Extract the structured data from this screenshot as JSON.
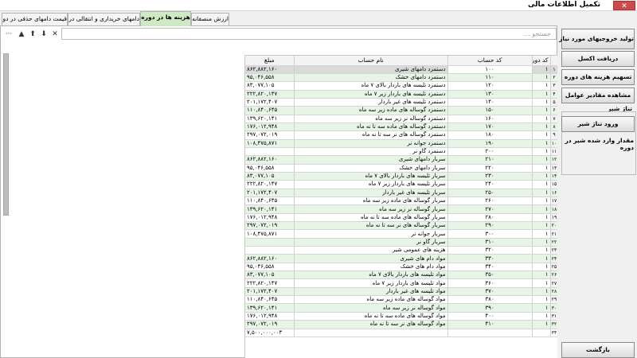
{
  "window": {
    "title": "تکمیل اطلاعات مالی",
    "close_label": "✕"
  },
  "tabs": [
    "ارزش منصفانه",
    "هزینه ها در دوره",
    "دامهای خریداری و انتقالی در دوره",
    "قیمت دامهای حذفی در دوره"
  ],
  "active_tab": "هزینه ها در دوره",
  "toolbar": {
    "more": "···",
    "up": "▲",
    "up2": "⬆",
    "down": "⬇",
    "clear": "✕"
  },
  "search": {
    "placeholder": "جستجو ..."
  },
  "grid": {
    "columns": {
      "period": "کد دوره",
      "account_code": "کد حساب",
      "account_name": "نام حساب",
      "amount": "مبلغ"
    },
    "rows": [
      {
        "row": "۱",
        "period": "۱",
        "code": "۱۰۰",
        "name": "دستمزد دامهای شیری",
        "amount": "۸۶۲,۸۸۲,۱۶۰"
      },
      {
        "row": "۲",
        "period": "۱",
        "code": "۱۱۰",
        "name": "دستمزد دامهای خشک",
        "amount": "۹۵,۰۴۶,۵۵۸"
      },
      {
        "row": "۳",
        "period": "۱",
        "code": "۱۲۰",
        "name": "دستمزد تلیسه های باردار بالای ۷ ماه",
        "amount": "۸۳,۰۷۷,۱۰۵"
      },
      {
        "row": "۴",
        "period": "۱",
        "code": "۱۳۰",
        "name": "دستمزد تلیسه های باردار زیر ۷ ماه",
        "amount": "۲۲۲,۸۲۰,۱۴۷"
      },
      {
        "row": "۵",
        "period": "۱",
        "code": "۱۴۰",
        "name": "دستمزد تلیسه های غیر باردار",
        "amount": "۲۰۱,۱۷۲,۴۰۷"
      },
      {
        "row": "۶",
        "period": "۱",
        "code": "۱۵۰",
        "name": "دستمزد گوساله های ماده زیر سه ماه",
        "amount": "۱۱۰,۸۴۰,۶۴۵"
      },
      {
        "row": "۷",
        "period": "۱",
        "code": "۱۶۰",
        "name": "دستمزد گوساله نر زیر سه ماه",
        "amount": "۱۳۹,۶۲۰,۱۴۱"
      },
      {
        "row": "۸",
        "period": "۱",
        "code": "۱۷۰",
        "name": "دستمزد گوساله های ماده سه تا نه ماه",
        "amount": "۱۷۶,۰۱۲,۹۴۸"
      },
      {
        "row": "۹",
        "period": "۱",
        "code": "۱۸۰",
        "name": "دستمزد گوساله های نر سه تا نه ماه",
        "amount": "۲۹۷,۰۷۲,۰۱۹"
      },
      {
        "row": "۱۰",
        "period": "۱",
        "code": "۱۹۰",
        "name": "دستمزد جوانه نر",
        "amount": "۱۰۸,۴۷۵,۸۷۱"
      },
      {
        "row": "۱۱",
        "period": "۱",
        "code": "۲۰۰",
        "name": "دستمزد گاو نر",
        "amount": ""
      },
      {
        "row": "۱۲",
        "period": "۱",
        "code": "۲۱۰",
        "name": "سربار دامهای شیری",
        "amount": "۸۶۲,۸۸۲,۱۶۰"
      },
      {
        "row": "۱۳",
        "period": "۱",
        "code": "۲۲۰",
        "name": "سربار دامهای خشک",
        "amount": "۹۵,۰۴۶,۵۵۸"
      },
      {
        "row": "۱۴",
        "period": "۱",
        "code": "۲۳۰",
        "name": "سربار تلیسه های باردار بالای ۷ ماه",
        "amount": "۸۳,۰۷۷,۱۰۵"
      },
      {
        "row": "۱۵",
        "period": "۱",
        "code": "۲۴۰",
        "name": "سربار تلیسه های باردار زیر ۷ ماه",
        "amount": "۲۲۲,۸۲۰,۱۴۷"
      },
      {
        "row": "۱۶",
        "period": "۱",
        "code": "۲۵۰",
        "name": "سربار تلیسه های غیر باردار",
        "amount": "۲۰۱,۱۷۲,۴۰۷"
      },
      {
        "row": "۱۷",
        "period": "۱",
        "code": "۲۶۰",
        "name": "سربار گوساله های ماده زیر سه ماه",
        "amount": "۱۱۰,۸۴۰,۶۴۵"
      },
      {
        "row": "۱۸",
        "period": "۱",
        "code": "۲۷۰",
        "name": "سربار گوساله نر زیر سه ماه",
        "amount": "۱۳۹,۶۲۰,۱۴۱"
      },
      {
        "row": "۱۹",
        "period": "۱",
        "code": "۲۸۰",
        "name": "سربار گوساله های ماده سه تا نه ماه",
        "amount": "۱۷۶,۰۱۲,۹۴۸"
      },
      {
        "row": "۲۰",
        "period": "۱",
        "code": "۲۹۰",
        "name": "سربار گوساله های نر سه تا نه ماه",
        "amount": "۲۹۷,۰۷۲,۰۱۹"
      },
      {
        "row": "۲۱",
        "period": "۱",
        "code": "۳۰۰",
        "name": "سربار جوانه نر",
        "amount": "۱۰۸,۴۷۵,۸۷۱"
      },
      {
        "row": "۲۲",
        "period": "۱",
        "code": "۳۱۰",
        "name": "سربار گاو نر",
        "amount": ""
      },
      {
        "row": "۲۳",
        "period": "۱",
        "code": "۳۲۰",
        "name": "هزینه های عمومی شیر",
        "amount": ""
      },
      {
        "row": "۲۴",
        "period": "۱",
        "code": "۳۳۰",
        "name": "مواد دام های شیری",
        "amount": "۸۶۲,۸۸۲,۱۶۰"
      },
      {
        "row": "۲۵",
        "period": "۱",
        "code": "۳۴۰",
        "name": "مواد دام های خشک",
        "amount": "۹۵,۰۴۶,۵۵۸"
      },
      {
        "row": "۲۶",
        "period": "۱",
        "code": "۳۵۰",
        "name": "مواد تلیسه های باردار بالای ۷ ماه",
        "amount": "۸۳,۰۷۷,۱۰۵"
      },
      {
        "row": "۲۷",
        "period": "۱",
        "code": "۳۶۰",
        "name": "مواد تلیسه های باردار زیر ۷ ماه",
        "amount": "۲۲۲,۸۲۰,۱۴۷"
      },
      {
        "row": "۲۸",
        "period": "۱",
        "code": "۳۷۰",
        "name": "مواد تلیسه های غیر باردار",
        "amount": "۲۰۱,۱۷۲,۴۰۷"
      },
      {
        "row": "۲۹",
        "period": "۱",
        "code": "۳۸۰",
        "name": "مواد گوساله های ماده زیر سه ماه",
        "amount": "۱۱۰,۸۴۰,۶۴۵"
      },
      {
        "row": "۳۰",
        "period": "۱",
        "code": "۳۹۰",
        "name": "مواد گوساله نر زیر سه ماه",
        "amount": "۱۳۹,۶۲۰,۱۴۱"
      },
      {
        "row": "۳۱",
        "period": "۱",
        "code": "۴۰۰",
        "name": "مواد گوساله های ماده سه تا نه ماه",
        "amount": "۱۷۶,۰۱۲,۹۴۸"
      },
      {
        "row": "۳۲",
        "period": "۱",
        "code": "۴۱۰",
        "name": "مواد گوساله های نر سه تا نه ماه",
        "amount": "۲۹۷,۰۷۲,۰۱۹"
      }
    ],
    "total_row": {
      "row": "۳۴",
      "amount": "۷,۵۰۰,۰۰۰,۰۰۳"
    }
  },
  "sidebar": {
    "buttons": {
      "generate_outputs": "تولید خروجیهای مورد نیاز",
      "get_excel": "دریافت اکسل",
      "split_costs": "تسهیم هزینه های دوره",
      "view_factors": "مشاهده مقادیر عوامل",
      "enter_milk": "ورود تناژ شیر",
      "back": "بازگشت"
    },
    "milk_group_label": "تناژ شیر",
    "milk_note": "مقدار وارد شده شیر در دوره"
  },
  "colors": {
    "alt_row": "#e6f5e6",
    "active_tab": "#cdeac4",
    "close": "#c94b4b"
  }
}
